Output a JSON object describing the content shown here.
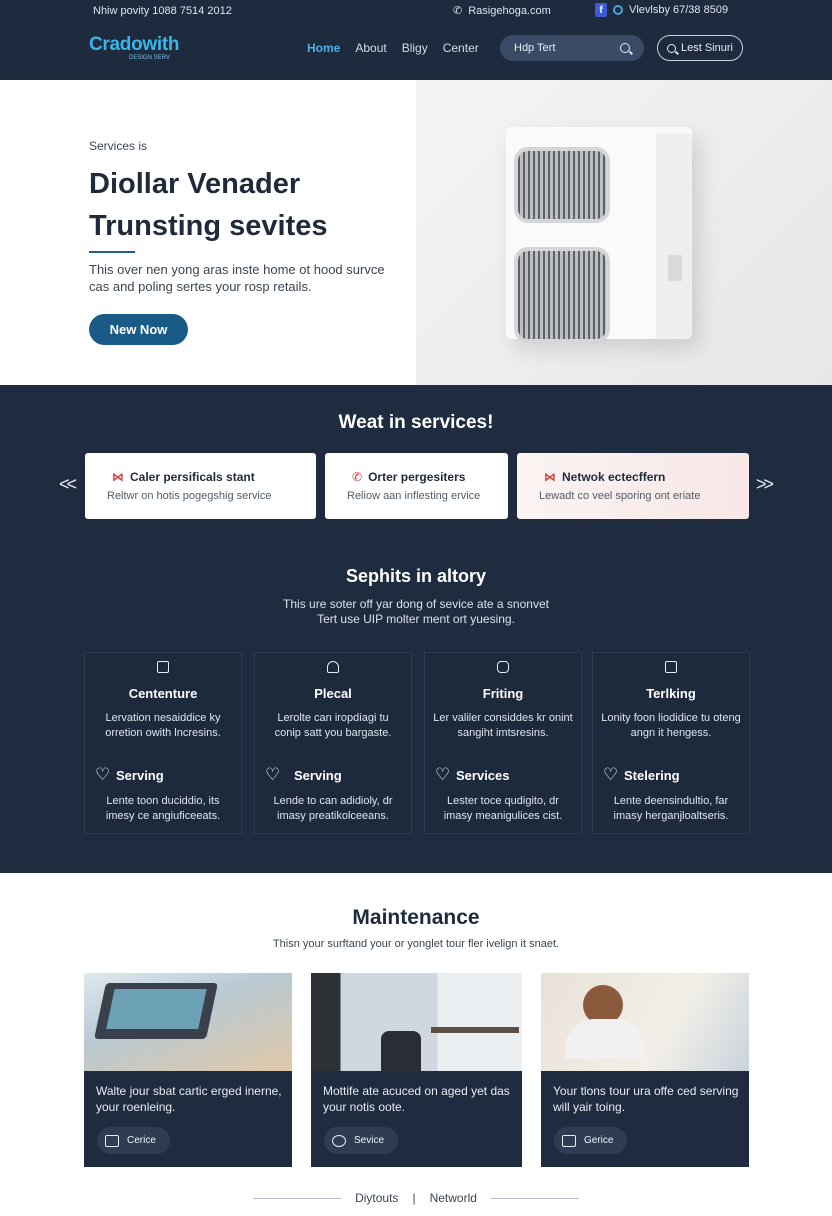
{
  "topbar": {
    "left_text": "Nhiw povity 1088 7514 2012",
    "email": "Rasigehoga.com",
    "right_text": "Vlevlsby 67/38 8509",
    "icons": [
      "phone-icon",
      "facebook-icon",
      "social-icon"
    ]
  },
  "header": {
    "logo_name": "Cradowith",
    "logo_tag": "DESIGN SERV",
    "nav": [
      {
        "label": "Home",
        "active": true
      },
      {
        "label": "About",
        "active": false
      },
      {
        "label": "Bligy",
        "active": false
      },
      {
        "label": "Center",
        "active": false
      }
    ],
    "search_placeholder": "Hdp Tert",
    "login_label": "Lest Sinuri"
  },
  "hero": {
    "eyebrow": "Services is",
    "title": "Diollar Venader Trunsting sevites",
    "description": "This over nen yong aras inste home ot hood survce cas and poling sertes your rosp retails.",
    "cta": "New Now"
  },
  "services": {
    "heading": "Weat in services!",
    "prev_arrow": "<<",
    "next_arrow": ">>",
    "cards": [
      {
        "title": "Caler persificals stant",
        "subtitle": "Reltwr on hotis pogegshig service"
      },
      {
        "title": "Orter pergesiters",
        "subtitle": "Reliow aan inflesting ervice"
      },
      {
        "title": "Netwok ectecffern",
        "subtitle": "Lewadt co veel sporing ont eriate"
      }
    ],
    "sub_heading": "Sephits in altory",
    "intro_line1": "This ure soter off yar dong of sevice ate a snonvet",
    "intro_line2": "Tert use UIP molter ment ort yuesing.",
    "features": [
      {
        "title": "Cententure",
        "text": "Lervation nesaiddice ky orretion owith lncresins.",
        "sub": "Serving",
        "text2": "Lente toon duciddio, its imesy ce angiuficeeats."
      },
      {
        "title": "Plecal",
        "text": "Lerolte can iropdiagi tu conip satt you bargaste.",
        "sub": "Serving",
        "text2": "Lende to can adidioly, dr imasy preatikolceeans."
      },
      {
        "title": "Friting",
        "text": "Ler valiler considdes kr onint sangiht imtsresins.",
        "sub": "Services",
        "text2": "Lester toce qudigito, dr imasy meanigulices cist."
      },
      {
        "title": "Terlking",
        "text": "Lonity foon liodidice tu oteng angn it hengess.",
        "sub": "Stelering",
        "text2": "Lente deensindultio, far imasy herganjloaltseris."
      }
    ]
  },
  "maintenance": {
    "heading": "Maintenance",
    "intro": "Thisn your surftand your or yonglet tour fler ivelign it snaet.",
    "cards": [
      {
        "text": "Walte jour sbat cartic erged inerne, your roenleing.",
        "pill": "Cerice"
      },
      {
        "text": "Mottife ate acuced on aged yet das your notis oote.",
        "pill": "Sevice"
      },
      {
        "text": "Your tlons tour ura offe ced serving will yair toing.",
        "pill": "Gerice"
      }
    ]
  },
  "footer": {
    "left": "Diytouts",
    "separator": "|",
    "right": "Networld"
  },
  "colors": {
    "navy": "#1e2a3d",
    "accent": "#3ab5ea",
    "cta": "#195a86",
    "icon_red": "#d8343b"
  }
}
